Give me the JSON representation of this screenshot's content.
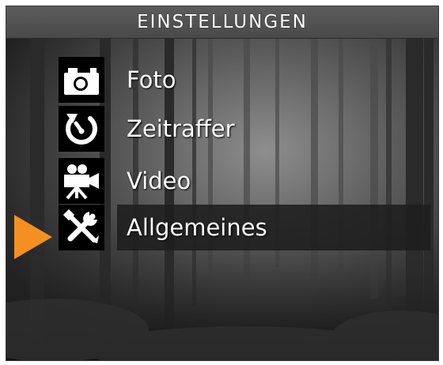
{
  "title": "EINSTELLUNGEN",
  "menu": {
    "items": [
      {
        "label": "Foto",
        "icon": "camera-icon"
      },
      {
        "label": "Zeitraffer",
        "icon": "timelapse-icon"
      },
      {
        "label": "Video",
        "icon": "video-camera-icon"
      },
      {
        "label": "Allgemeines",
        "icon": "tools-icon"
      }
    ],
    "selected": "Allgemeines"
  },
  "colors": {
    "cursor": "#f39021",
    "title_bar": "#555555",
    "icon_bg": "#000000",
    "text": "#ffffff"
  }
}
